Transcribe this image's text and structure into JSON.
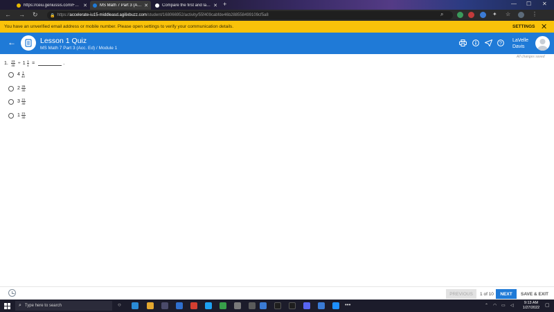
{
  "browser": {
    "tabs": [
      {
        "label": "https://ceiu.geniussis.com/FEDiv",
        "active": false,
        "favicon_color": "#e6b800"
      },
      {
        "label": "MS Math 7 Part 3 (Acc. Ed) - Acti",
        "active": true,
        "favicon_color": "#1f7ad7"
      },
      {
        "label": "Compare the first and last versi",
        "active": false,
        "favicon_color": "#ffffff"
      }
    ],
    "new_tab": "+",
    "url_scheme": "https://",
    "url_host": "accelerate-iu15-middleasd.agilixbuzz.com",
    "url_path": "/student/168066952/activity/55f409cabfde46b288558499109cf5a8"
  },
  "banner": {
    "message": "You have an unverified email address or mobile number. Please open settings to verify your communication details.",
    "settings_label": "SETTINGS",
    "close_icon": "✕"
  },
  "header": {
    "title": "Lesson 1 Quiz",
    "subtitle": "MS Math 7 Part 3 (Acc. Ed) / Module 1",
    "user_first": "LaVelle",
    "user_last": "Davis",
    "saved_status": "All changes saved"
  },
  "question": {
    "number": "1.",
    "a_num": "23",
    "a_den": "40",
    "op": "÷",
    "b_whole": "1",
    "b_num": "1",
    "b_den": "4",
    "equals": "=",
    "end": ".",
    "choices": [
      {
        "whole": "4",
        "num": "1",
        "den": "40"
      },
      {
        "whole": "2",
        "num": "26",
        "den": "40"
      },
      {
        "whole": "3",
        "num": "21",
        "den": "40"
      },
      {
        "whole": "1",
        "num": "21",
        "den": "40"
      }
    ]
  },
  "footer": {
    "previous_label": "PREVIOUS",
    "page_count": "1 of 10",
    "next_label": "NEXT",
    "save_exit_label": "SAVE & EXIT"
  },
  "taskbar": {
    "search_placeholder": "Type here to search",
    "time": "9:13 AM",
    "date": "1/27/2022"
  },
  "colors": {
    "accent": "#1f7ad7",
    "banner": "#f9c20a"
  }
}
